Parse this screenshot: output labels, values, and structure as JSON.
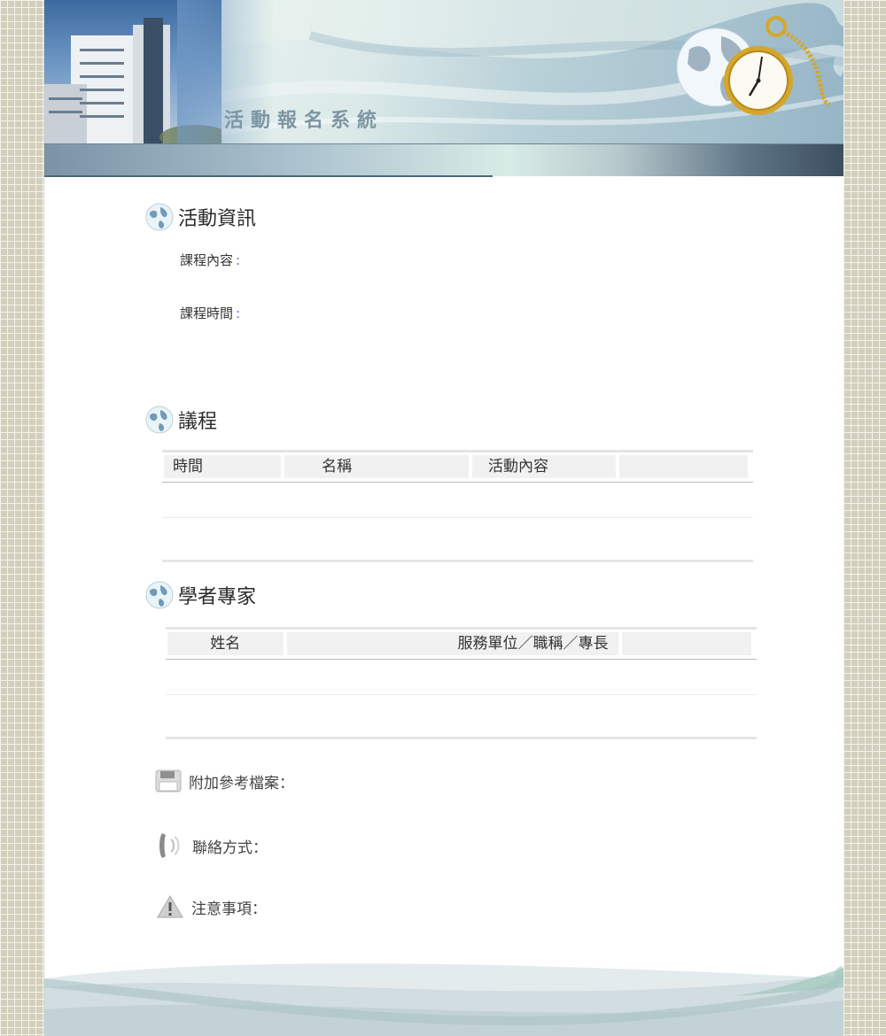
{
  "banner": {
    "title": "活動報名系統"
  },
  "activity_info": {
    "title": "活動資訊",
    "course_content_label": "課程內容",
    "course_time_label": "課程時間",
    "colon": ":"
  },
  "agenda": {
    "title": "議程",
    "columns": [
      "時間",
      "名稱",
      "活動內容",
      ""
    ]
  },
  "experts": {
    "title": "學者專家",
    "columns": [
      "姓名",
      "服務單位／職稱／專長",
      ""
    ]
  },
  "extras": {
    "attachments_label": "附加參考檔案：",
    "contact_label": "聯絡方式：",
    "notice_label": "注意事項："
  },
  "icons": {
    "section_icon": "globe-icon",
    "attachments_icon": "disk-icon",
    "contact_icon": "phone-icon",
    "notice_icon": "warning-icon"
  },
  "colors": {
    "background": "#d3cfbd",
    "banner_bar_dark": "#3c4e5e",
    "accent_colon": "#5a6fd0"
  }
}
